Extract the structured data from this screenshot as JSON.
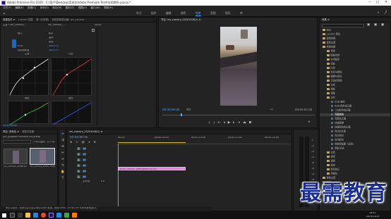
{
  "titlebar": {
    "title": "Adobe Premiere Pro 2020 - C:\\用户\\Desktop\\怎样在Adobe Premiere Pro中应用颜色.prproj *",
    "controls": [
      "—",
      "□",
      "✕"
    ]
  },
  "menu": [
    "文件(F)",
    "编辑(E)",
    "剪辑(C)",
    "序列(S)",
    "标记(M)",
    "图形(G)",
    "视图(V)",
    "窗口(W)",
    "帮助(H)"
  ],
  "workspaces": [
    "学习",
    "组件",
    "编辑",
    "颜色",
    "效果",
    "音频",
    "图形",
    "库"
  ],
  "active_workspace": "效果",
  "effect_controls": {
    "tabs": [
      "效果控件 ≡",
      "Lumetri 范围",
      "源: (无剪辑)",
      "音频剪辑混合器: sm_camera"
    ],
    "source_label": "主要 * xm_camera_...",
    "sequence_label": "xm_camera_...",
    "timecode_top": "00:00",
    "rows": [
      "输入",
      "基本",
      "曲线",
      "色轮",
      "RGB",
      "色相饱和度"
    ],
    "values": [
      "100.0 %",
      "100.0 %"
    ],
    "curve_labels": [
      "主要",
      "红色",
      "绿色",
      "蓝色"
    ],
    "timecode": "00:00:00:00"
  },
  "program_monitor": {
    "tab": "节目: xm_camera_20201008(1) ≡",
    "timecode": "00:00:00:00",
    "fit": "适合",
    "scale": "1/2",
    "duration": "00:00:05:00"
  },
  "project": {
    "tabs": [
      "项目: 未命名 ≡",
      "媒体浏览器"
    ],
    "file": "怎么在Adobe Premiere Pro.prproj",
    "count": "1 项已选择，共 2 项",
    "items": [
      {
        "name": "xm_camera_2020...",
        "duration": "5:00"
      },
      {
        "name": "xm_camera_2020...",
        "duration": "5:00"
      }
    ]
  },
  "timeline": {
    "tab": "xm_camera_20201008(1) ≡",
    "timecode": "00:00:00:00",
    "ruler": [
      "00:00",
      "00:00:05:00",
      "00:00:10:00",
      "00:00:15:00",
      "00:00:20:00"
    ],
    "video_tracks": [
      "V3",
      "V2",
      "V1"
    ],
    "audio_tracks": [
      "A1",
      "A2",
      "A3"
    ],
    "master": "主声道",
    "master_value": "0.0",
    "clip": "fx xm_camera_2020100817(1).jpg"
  },
  "effects_panel": {
    "title": "效果 ≡",
    "items": [
      {
        "label": "预设",
        "kind": "folder",
        "indent": 0
      },
      {
        "label": "Lumetri 预设",
        "kind": "folder",
        "indent": 0
      },
      {
        "label": "音频效果",
        "kind": "folder",
        "indent": 0
      },
      {
        "label": "音频过渡",
        "kind": "folder",
        "indent": 0
      },
      {
        "label": "视频效果",
        "kind": "folder",
        "indent": 0
      },
      {
        "label": "变换",
        "kind": "folder",
        "indent": 1
      },
      {
        "label": "图像控制",
        "kind": "folder",
        "indent": 1
      },
      {
        "label": "实用程序",
        "kind": "folder",
        "indent": 1
      },
      {
        "label": "扭曲",
        "kind": "folder",
        "indent": 1
      },
      {
        "label": "时间",
        "kind": "folder",
        "indent": 1
      },
      {
        "label": "杂色与颗粒",
        "kind": "folder",
        "indent": 1
      },
      {
        "label": "模糊与锐化",
        "kind": "folder",
        "indent": 1
      },
      {
        "label": "沉浸式视频",
        "kind": "folder",
        "indent": 1
      },
      {
        "label": "生成",
        "kind": "folder",
        "indent": 1
      },
      {
        "label": "视频",
        "kind": "folder",
        "indent": 1
      },
      {
        "label": "调整",
        "kind": "folder",
        "indent": 1
      },
      {
        "label": "过时",
        "kind": "folder",
        "indent": 1
      },
      {
        "label": "RGB 曲线",
        "kind": "fx",
        "indent": 2
      },
      {
        "label": "RGB 颜色校正器",
        "kind": "fx",
        "indent": 2
      },
      {
        "label": "三向颜色校正器",
        "kind": "fx",
        "indent": 2
      },
      {
        "label": "亮度曲线",
        "kind": "fx",
        "indent": 2
      },
      {
        "label": "亮度校正器",
        "kind": "fx",
        "indent": 2
      },
      {
        "label": "快速模糊",
        "kind": "fx",
        "indent": 2
      },
      {
        "label": "快速颜色校正器",
        "kind": "fx",
        "indent": 2
      },
      {
        "label": "自动对比度",
        "kind": "fx",
        "indent": 2
      },
      {
        "label": "自动色阶",
        "kind": "fx",
        "indent": 2
      },
      {
        "label": "自动颜色",
        "kind": "fx",
        "indent": 2
      },
      {
        "label": "视频限幅器（旧版）",
        "kind": "fx",
        "indent": 2
      },
      {
        "label": "阴影/高光",
        "kind": "fx",
        "indent": 2
      },
      {
        "label": "过渡",
        "kind": "folder",
        "indent": 1
      },
      {
        "label": "透视",
        "kind": "folder",
        "indent": 1
      },
      {
        "label": "通道",
        "kind": "folder",
        "indent": 1
      },
      {
        "label": "键控",
        "kind": "folder",
        "indent": 1
      },
      {
        "label": "颜色校正",
        "kind": "folder",
        "indent": 1
      },
      {
        "label": "风格化",
        "kind": "folder",
        "indent": 1
      },
      {
        "label": "视频过渡",
        "kind": "folder",
        "indent": 0
      }
    ],
    "selected_index": 20,
    "bottom_label": "基本图形"
  },
  "status_bar": "单击以选择，或单击空白处并拖动以进行框选。使用 Shift、Alt 和 Ctrl 可获得其他选项。",
  "watermark": "最需教育",
  "clock": {
    "time": "14:47",
    "date": "2021/11/24"
  },
  "colors": {
    "accent": "#4da6ff",
    "clip": "#d98ad6",
    "watermark": "#1a2e8f"
  }
}
